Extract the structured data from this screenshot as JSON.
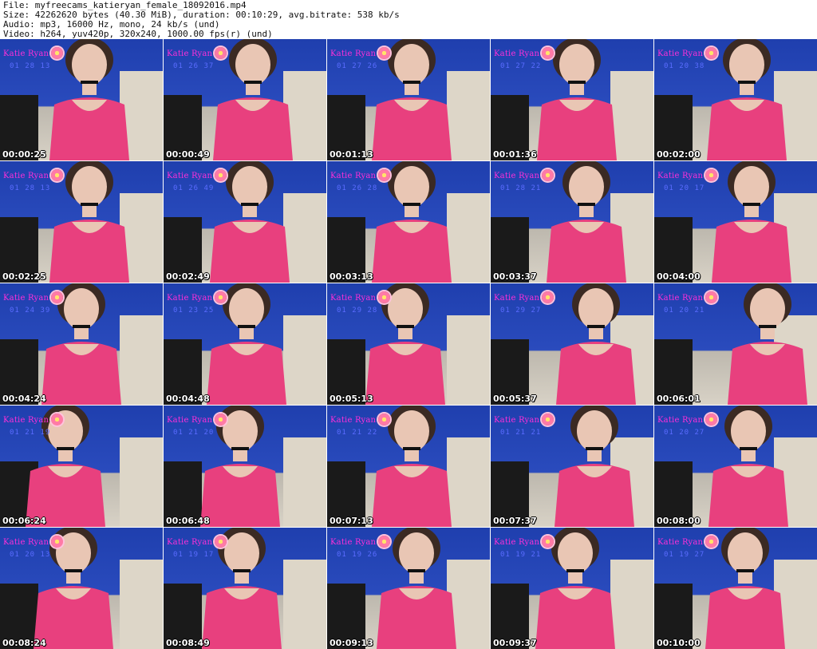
{
  "header": {
    "file_line": "File: myfreecams_katieryan_female_18092016.mp4",
    "size_line": "Size: 42262620 bytes (40.30 MiB), duration: 00:10:29, avg.bitrate: 538 kb/s",
    "audio_line": "Audio: mp3, 16000 Hz, mono, 24 kb/s (und)",
    "video_line": "Video: h264, yuv420p, 320x240, 1000.00 fps(r) (und)"
  },
  "overlay": {
    "brand": "Katie Ryan"
  },
  "thumbnails": [
    {
      "timestamp": "00:00:25",
      "clock": "01 28 13"
    },
    {
      "timestamp": "00:00:49",
      "clock": "01 26 37"
    },
    {
      "timestamp": "00:01:13",
      "clock": "01 27 26"
    },
    {
      "timestamp": "00:01:36",
      "clock": "01 27 22"
    },
    {
      "timestamp": "00:02:00",
      "clock": "01 20 38"
    },
    {
      "timestamp": "00:02:25",
      "clock": "01 28 13"
    },
    {
      "timestamp": "00:02:49",
      "clock": "01 26 49"
    },
    {
      "timestamp": "00:03:13",
      "clock": "01 26 28"
    },
    {
      "timestamp": "00:03:37",
      "clock": "01 28 21"
    },
    {
      "timestamp": "00:04:00",
      "clock": "01 20 17"
    },
    {
      "timestamp": "00:04:24",
      "clock": "01 24 39"
    },
    {
      "timestamp": "00:04:48",
      "clock": "01 23 25"
    },
    {
      "timestamp": "00:05:13",
      "clock": "01 29 28"
    },
    {
      "timestamp": "00:05:37",
      "clock": "01 29 27"
    },
    {
      "timestamp": "00:06:01",
      "clock": "01 20 21"
    },
    {
      "timestamp": "00:06:24",
      "clock": "01 21 19"
    },
    {
      "timestamp": "00:06:48",
      "clock": "01 21 20"
    },
    {
      "timestamp": "00:07:13",
      "clock": "01 21 22"
    },
    {
      "timestamp": "00:07:37",
      "clock": "01 21 21"
    },
    {
      "timestamp": "00:08:00",
      "clock": "01 20 27"
    },
    {
      "timestamp": "00:08:24",
      "clock": "01 20 13"
    },
    {
      "timestamp": "00:08:49",
      "clock": "01 19 17"
    },
    {
      "timestamp": "00:09:13",
      "clock": "01 19 26"
    },
    {
      "timestamp": "00:09:37",
      "clock": "01 19 21"
    },
    {
      "timestamp": "00:10:00",
      "clock": "01 19 27"
    }
  ],
  "colors": {
    "wall_blue": "#1f3fae",
    "shirt_pink": "#e8407e",
    "skirt_blue": "#1f7fd8",
    "couch": "#ddd6c8",
    "skin": "#e9c6b4",
    "hair": "#3b2a23",
    "brand_pink": "#ff2fd8",
    "clock_blue": "#5a6cff"
  }
}
